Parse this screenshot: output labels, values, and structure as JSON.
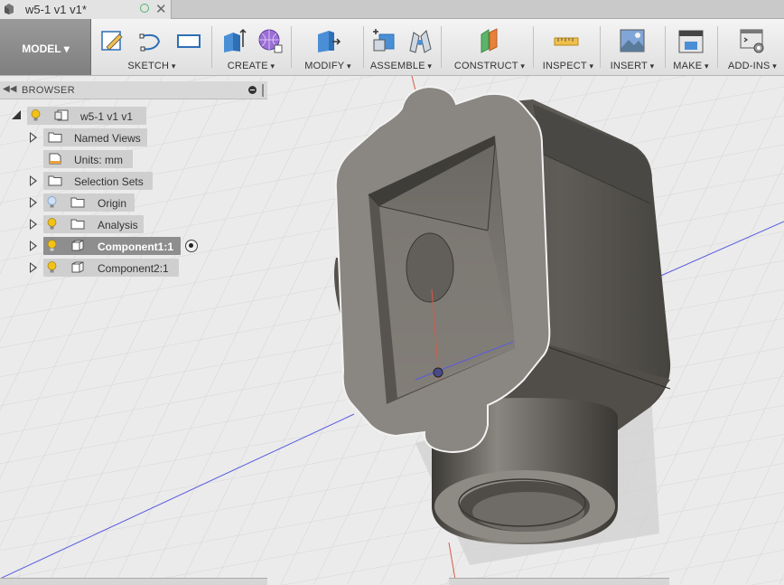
{
  "document_tab": {
    "title": "w5-1 v1 v1*"
  },
  "toolbar": {
    "workspace_label": "MODEL ▾",
    "groups": [
      {
        "label": "SKETCH"
      },
      {
        "label": "CREATE"
      },
      {
        "label": "MODIFY"
      },
      {
        "label": "ASSEMBLE"
      },
      {
        "label": "CONSTRUCT"
      },
      {
        "label": "INSPECT"
      },
      {
        "label": "INSERT"
      },
      {
        "label": "MAKE"
      },
      {
        "label": "ADD-INS"
      }
    ]
  },
  "browser": {
    "title": "BROWSER",
    "root": {
      "label": "w5-1 v1 v1"
    },
    "items": [
      {
        "label": "Named Views"
      },
      {
        "label": "Units: mm"
      },
      {
        "label": "Selection Sets"
      },
      {
        "label": "Origin"
      },
      {
        "label": "Analysis"
      },
      {
        "label": "Component1:1"
      },
      {
        "label": "Component2:1"
      }
    ]
  },
  "colors": {
    "accent_selected": "#8e8e8e",
    "bulb_on": "#f2c21b",
    "bulb_off": "#7fa6d6",
    "axis_red": "#d65a4a",
    "axis_blue": "#4b4bd6"
  }
}
